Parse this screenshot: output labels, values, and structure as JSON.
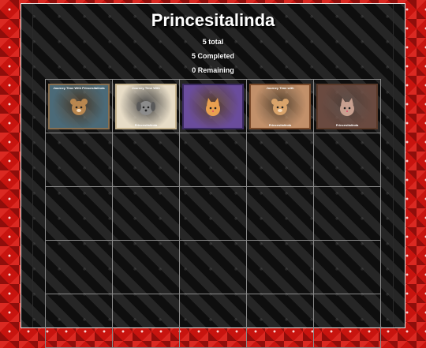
{
  "page": {
    "title": "Princesitalinda",
    "stats": {
      "total": "5 total",
      "completed": "5 Completed",
      "remaining": "0 Remaining"
    }
  },
  "grid": {
    "columns": 5,
    "rows": 5,
    "tiles": [
      {
        "name": "tag-teddy-bear",
        "caption_top": "Journey Time With Princesitalinda",
        "caption_bottom": "",
        "colors": {
          "bg": "#4b6a78",
          "accent": "#b9874f",
          "border": "#8a7050"
        },
        "icon": "bear-icon"
      },
      {
        "name": "tag-puppy-kitten",
        "caption_top": "Journey Time With",
        "caption_bottom": "Princesitalinda",
        "colors": {
          "bg": "#e7dcc6",
          "accent": "#8c8c8c",
          "border": "#c9b690"
        },
        "icon": "dog-icon"
      },
      {
        "name": "tag-cat-flowers",
        "caption_top": "",
        "caption_bottom": "",
        "colors": {
          "bg": "#6a4c9c",
          "accent": "#e9a050",
          "border": "#3a2a60"
        },
        "icon": "cat-icon"
      },
      {
        "name": "tag-bears-window",
        "caption_top": "Journey Time with",
        "caption_bottom": "Princesitalinda",
        "colors": {
          "bg": "#c2906a",
          "accent": "#d9a36a",
          "border": "#7a4a2a"
        },
        "icon": "bear-icon"
      },
      {
        "name": "tag-cat-family",
        "caption_top": "",
        "caption_bottom": "Princesitalinda",
        "colors": {
          "bg": "#6a4a40",
          "accent": "#c8a090",
          "border": "#5a3a2a"
        },
        "icon": "cat-icon"
      }
    ]
  }
}
